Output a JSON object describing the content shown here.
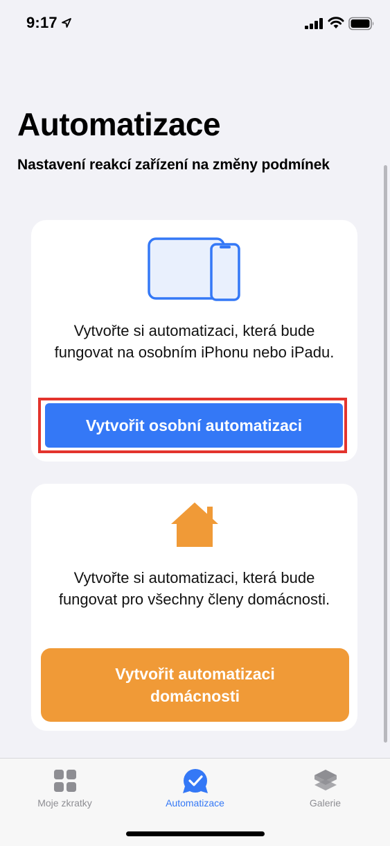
{
  "status_bar": {
    "time": "9:17",
    "icons": [
      "location-arrow-icon",
      "cellular-signal-icon",
      "wifi-icon",
      "battery-icon"
    ]
  },
  "header": {
    "title": "Automatizace",
    "subtitle": "Nastavení reakcí zařízení na změny podmínek"
  },
  "cards": {
    "personal": {
      "icon": "ipad-iphone-icon",
      "description": "Vytvořte si automatizaci, která bude fungovat na osobním iPhonu nebo iPadu.",
      "button_label": "Vytvořit osobní automatizaci"
    },
    "home": {
      "icon": "house-icon",
      "description": "Vytvořte si automatizaci, která bude fungovat pro všechny členy domácnosti.",
      "button_label": "Vytvořit automatizaci domácnosti"
    }
  },
  "tab_bar": {
    "tabs": [
      {
        "label": "Moje zkratky",
        "icon": "grid-icon",
        "active": false
      },
      {
        "label": "Automatizace",
        "icon": "automation-clock-check-icon",
        "active": true
      },
      {
        "label": "Galerie",
        "icon": "layers-icon",
        "active": false
      }
    ]
  },
  "colors": {
    "accent_blue": "#3478f6",
    "home_orange": "#f09a37",
    "highlight_red": "#e3342d",
    "background": "#f2f2f7"
  }
}
